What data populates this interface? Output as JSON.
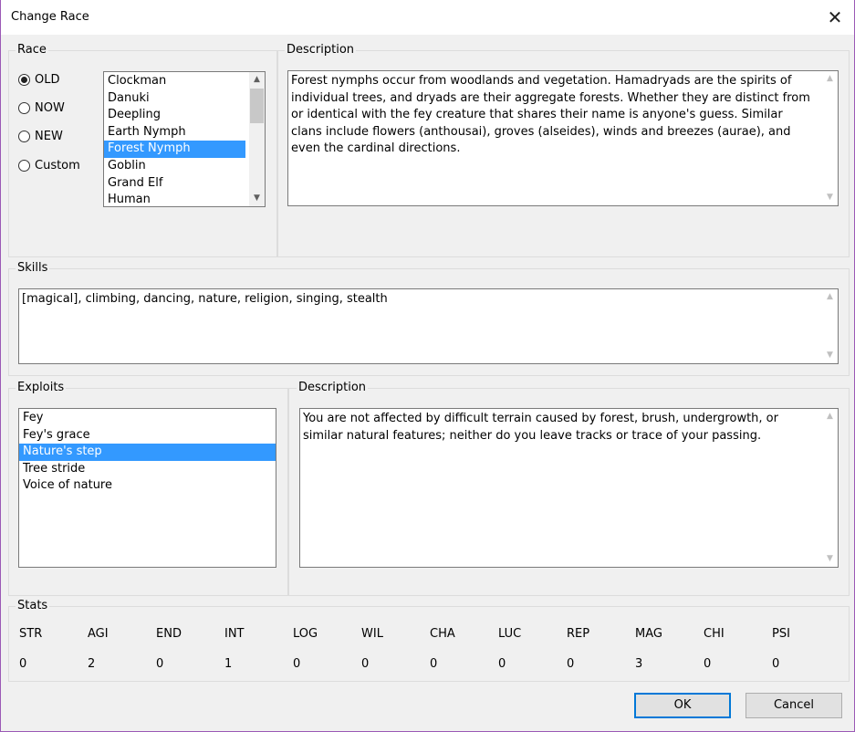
{
  "window": {
    "title": "Change Race",
    "close_label": "✕"
  },
  "race": {
    "group_label": "Race",
    "options": [
      {
        "label": "OLD",
        "selected": true
      },
      {
        "label": "NOW",
        "selected": false
      },
      {
        "label": "NEW",
        "selected": false
      },
      {
        "label": "Custom",
        "selected": false
      }
    ],
    "list": [
      "Clockman",
      "Danuki",
      "Deepling",
      "Earth Nymph",
      "Forest Nymph",
      "Goblin",
      "Grand Elf",
      "Human"
    ],
    "selected_index": 4
  },
  "race_description": {
    "group_label": "Description",
    "text": "Forest nymphs occur from woodlands and vegetation. Hamadryads are the spirits of individual trees, and dryads are their aggregate forests. Whether they are distinct from or identical with the fey creature that shares their name is anyone's guess. Similar clans include flowers (anthousai), groves (alseides), winds and breezes (aurae), and even the cardinal directions."
  },
  "skills": {
    "group_label": "Skills",
    "text": "[magical], climbing, dancing, nature, religion, singing, stealth"
  },
  "exploits": {
    "group_label": "Exploits",
    "list": [
      "Fey",
      "Fey's grace",
      "Nature's step",
      "Tree stride",
      "Voice of nature"
    ],
    "selected_index": 2
  },
  "exploit_description": {
    "group_label": "Description",
    "text": "You are not affected by difficult terrain caused by forest, brush, undergrowth, or similar natural features; neither do you leave tracks or trace of your passing."
  },
  "stats": {
    "group_label": "Stats",
    "items": [
      {
        "name": "STR",
        "value": "0"
      },
      {
        "name": "AGI",
        "value": "2"
      },
      {
        "name": "END",
        "value": "0"
      },
      {
        "name": "INT",
        "value": "1"
      },
      {
        "name": "LOG",
        "value": "0"
      },
      {
        "name": "WIL",
        "value": "0"
      },
      {
        "name": "CHA",
        "value": "0"
      },
      {
        "name": "LUC",
        "value": "0"
      },
      {
        "name": "REP",
        "value": "0"
      },
      {
        "name": "MAG",
        "value": "3"
      },
      {
        "name": "CHI",
        "value": "0"
      },
      {
        "name": "PSI",
        "value": "0"
      }
    ]
  },
  "buttons": {
    "ok": "OK",
    "cancel": "Cancel"
  },
  "icons": {
    "scroll_up": "▲",
    "scroll_down": "▼"
  }
}
